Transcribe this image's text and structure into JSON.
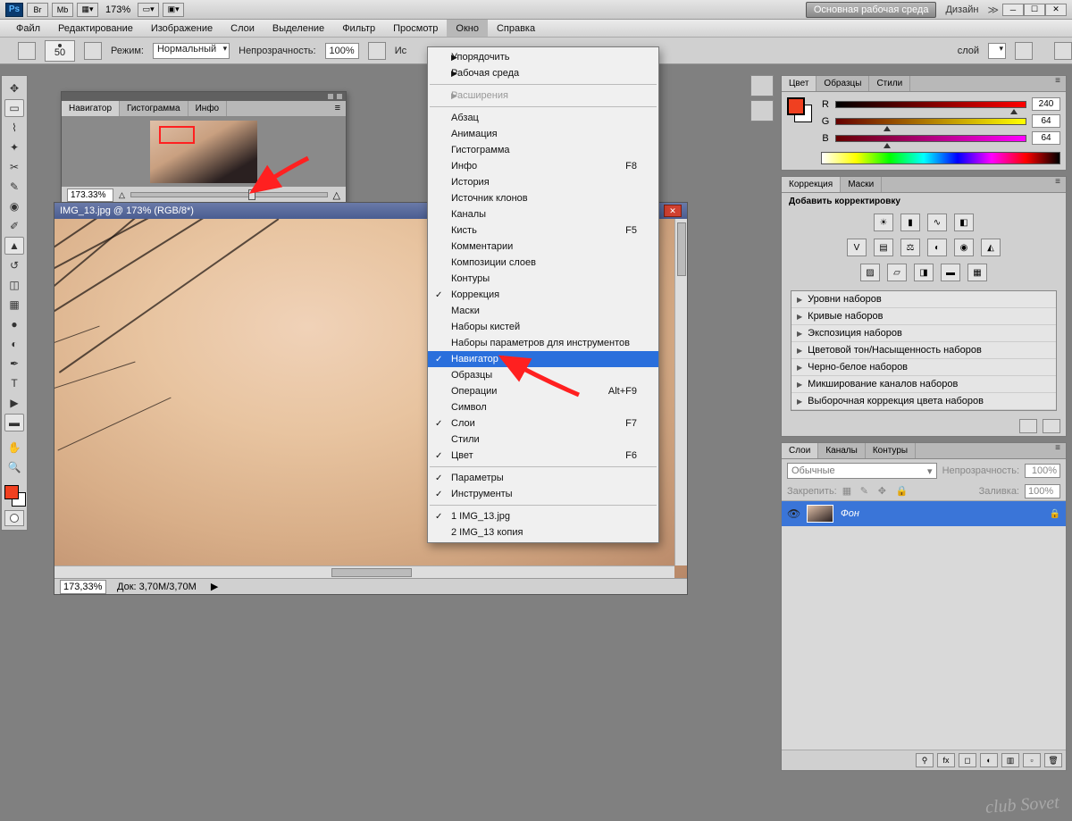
{
  "appbar": {
    "zoom": "173%",
    "workspace_btn": "Основная рабочая среда",
    "workspace_design": "Дизайн"
  },
  "menubar": [
    "Файл",
    "Редактирование",
    "Изображение",
    "Слои",
    "Выделение",
    "Фильтр",
    "Просмотр",
    "Окно",
    "Справка"
  ],
  "optbar": {
    "brush_size": "50",
    "mode_label": "Режим:",
    "mode_value": "Нормальный",
    "opacity_label": "Непрозрачность:",
    "opacity_value": "100%",
    "src_label": "Ис",
    "layer_label": "слой"
  },
  "navigator": {
    "tabs": [
      "Навигатор",
      "Гистограмма",
      "Инфо"
    ],
    "zoom_pct": "173.33%"
  },
  "document": {
    "title": "IMG_13.jpg @ 173% (RGB/8*)",
    "status_zoom": "173,33%",
    "status_doc": "Док: 3,70M/3,70M"
  },
  "window_menu": {
    "top": [
      "Упорядочить",
      "Рабочая среда"
    ],
    "ext": "Расширения",
    "items": [
      {
        "label": "Абзац"
      },
      {
        "label": "Анимация"
      },
      {
        "label": "Гистограмма"
      },
      {
        "label": "Инфо",
        "sc": "F8"
      },
      {
        "label": "История"
      },
      {
        "label": "Источник клонов"
      },
      {
        "label": "Каналы"
      },
      {
        "label": "Кисть",
        "sc": "F5"
      },
      {
        "label": "Комментарии"
      },
      {
        "label": "Композиции слоев"
      },
      {
        "label": "Контуры"
      },
      {
        "label": "Коррекция",
        "checked": true
      },
      {
        "label": "Маски"
      },
      {
        "label": "Наборы кистей"
      },
      {
        "label": "Наборы параметров для инструментов"
      },
      {
        "label": "Навигатор",
        "checked": true,
        "selected": true
      },
      {
        "label": "Образцы"
      },
      {
        "label": "Операции",
        "sc": "Alt+F9"
      },
      {
        "label": "Символ"
      },
      {
        "label": "Слои",
        "sc": "F7",
        "checked": true
      },
      {
        "label": "Стили"
      },
      {
        "label": "Цвет",
        "sc": "F6",
        "checked": true
      }
    ],
    "pref": [
      {
        "label": "Параметры",
        "checked": true
      },
      {
        "label": "Инструменты",
        "checked": true
      }
    ],
    "docs": [
      {
        "label": "1 IMG_13.jpg",
        "checked": true
      },
      {
        "label": "2 IMG_13 копия"
      }
    ]
  },
  "color_panel": {
    "tabs": [
      "Цвет",
      "Образцы",
      "Стили"
    ],
    "r": "240",
    "g": "64",
    "b": "64"
  },
  "adjust_panel": {
    "tabs": [
      "Коррекция",
      "Маски"
    ],
    "title": "Добавить корректировку",
    "presets": [
      "Уровни наборов",
      "Кривые наборов",
      "Экспозиция наборов",
      "Цветовой тон/Насыщенность наборов",
      "Черно-белое наборов",
      "Микширование каналов наборов",
      "Выборочная коррекция цвета наборов"
    ]
  },
  "layers_panel": {
    "tabs": [
      "Слои",
      "Каналы",
      "Контуры"
    ],
    "blend_mode": "Обычные",
    "opacity_lbl": "Непрозрачность:",
    "opacity_val": "100%",
    "lock_lbl": "Закрепить:",
    "fill_lbl": "Заливка:",
    "fill_val": "100%",
    "layer_name": "Фон"
  },
  "watermark": "club Sovet"
}
